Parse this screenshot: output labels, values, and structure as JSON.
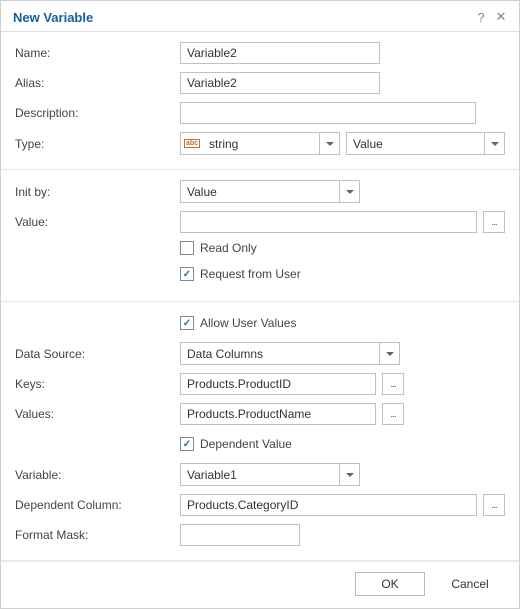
{
  "dialog": {
    "title": "New Variable",
    "help_icon": "?",
    "close_icon": "✕"
  },
  "labels": {
    "name": "Name:",
    "alias": "Alias:",
    "description": "Description:",
    "type": "Type:",
    "init_by": "Init by:",
    "value": "Value:",
    "data_source": "Data Source:",
    "keys": "Keys:",
    "values": "Values:",
    "variable": "Variable:",
    "dependent_column": "Dependent Column:",
    "format_mask": "Format Mask:"
  },
  "values": {
    "name": "Variable2",
    "alias": "Variable2",
    "description": "",
    "type": "string",
    "type_mode": "Value",
    "init_by": "Value",
    "value": "",
    "data_source": "Data Columns",
    "keys": "Products.ProductID",
    "values_col": "Products.ProductName",
    "variable": "Variable1",
    "dependent_column": "Products.CategoryID",
    "format_mask": ""
  },
  "checks": {
    "read_only": "Read Only",
    "request_from_user": "Request from User",
    "allow_user_values": "Allow User Values",
    "dependent_value": "Dependent Value"
  },
  "buttons": {
    "ok": "OK",
    "cancel": "Cancel",
    "ellipsis": "..."
  },
  "icons": {
    "type_icon": "abc"
  }
}
